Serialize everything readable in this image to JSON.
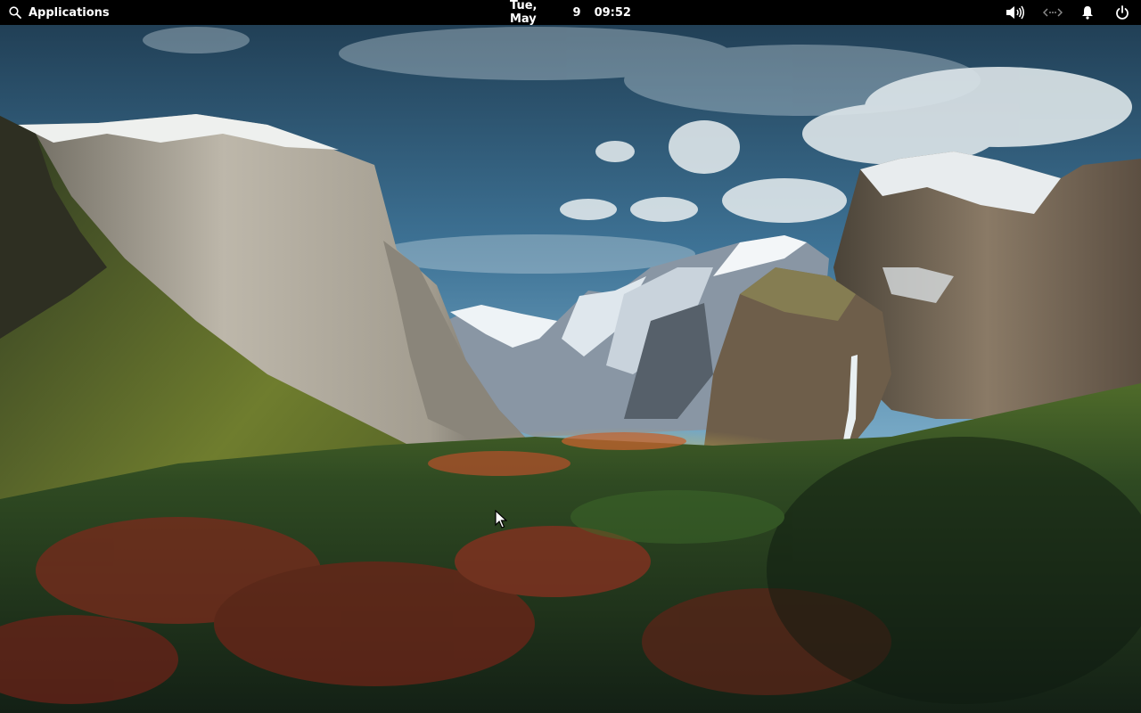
{
  "top_bar": {
    "applications_label": "Applications",
    "clock": {
      "day": "Tue, May",
      "date": "9",
      "time": "09:52"
    },
    "tray_icons": [
      "volume-icon",
      "network-icon",
      "notification-bell-icon",
      "power-icon"
    ]
  },
  "wallpaper": {
    "subject": "mountain valley landscape"
  },
  "colors": {
    "bar_background": "#000000",
    "bar_text": "#ffffff"
  }
}
